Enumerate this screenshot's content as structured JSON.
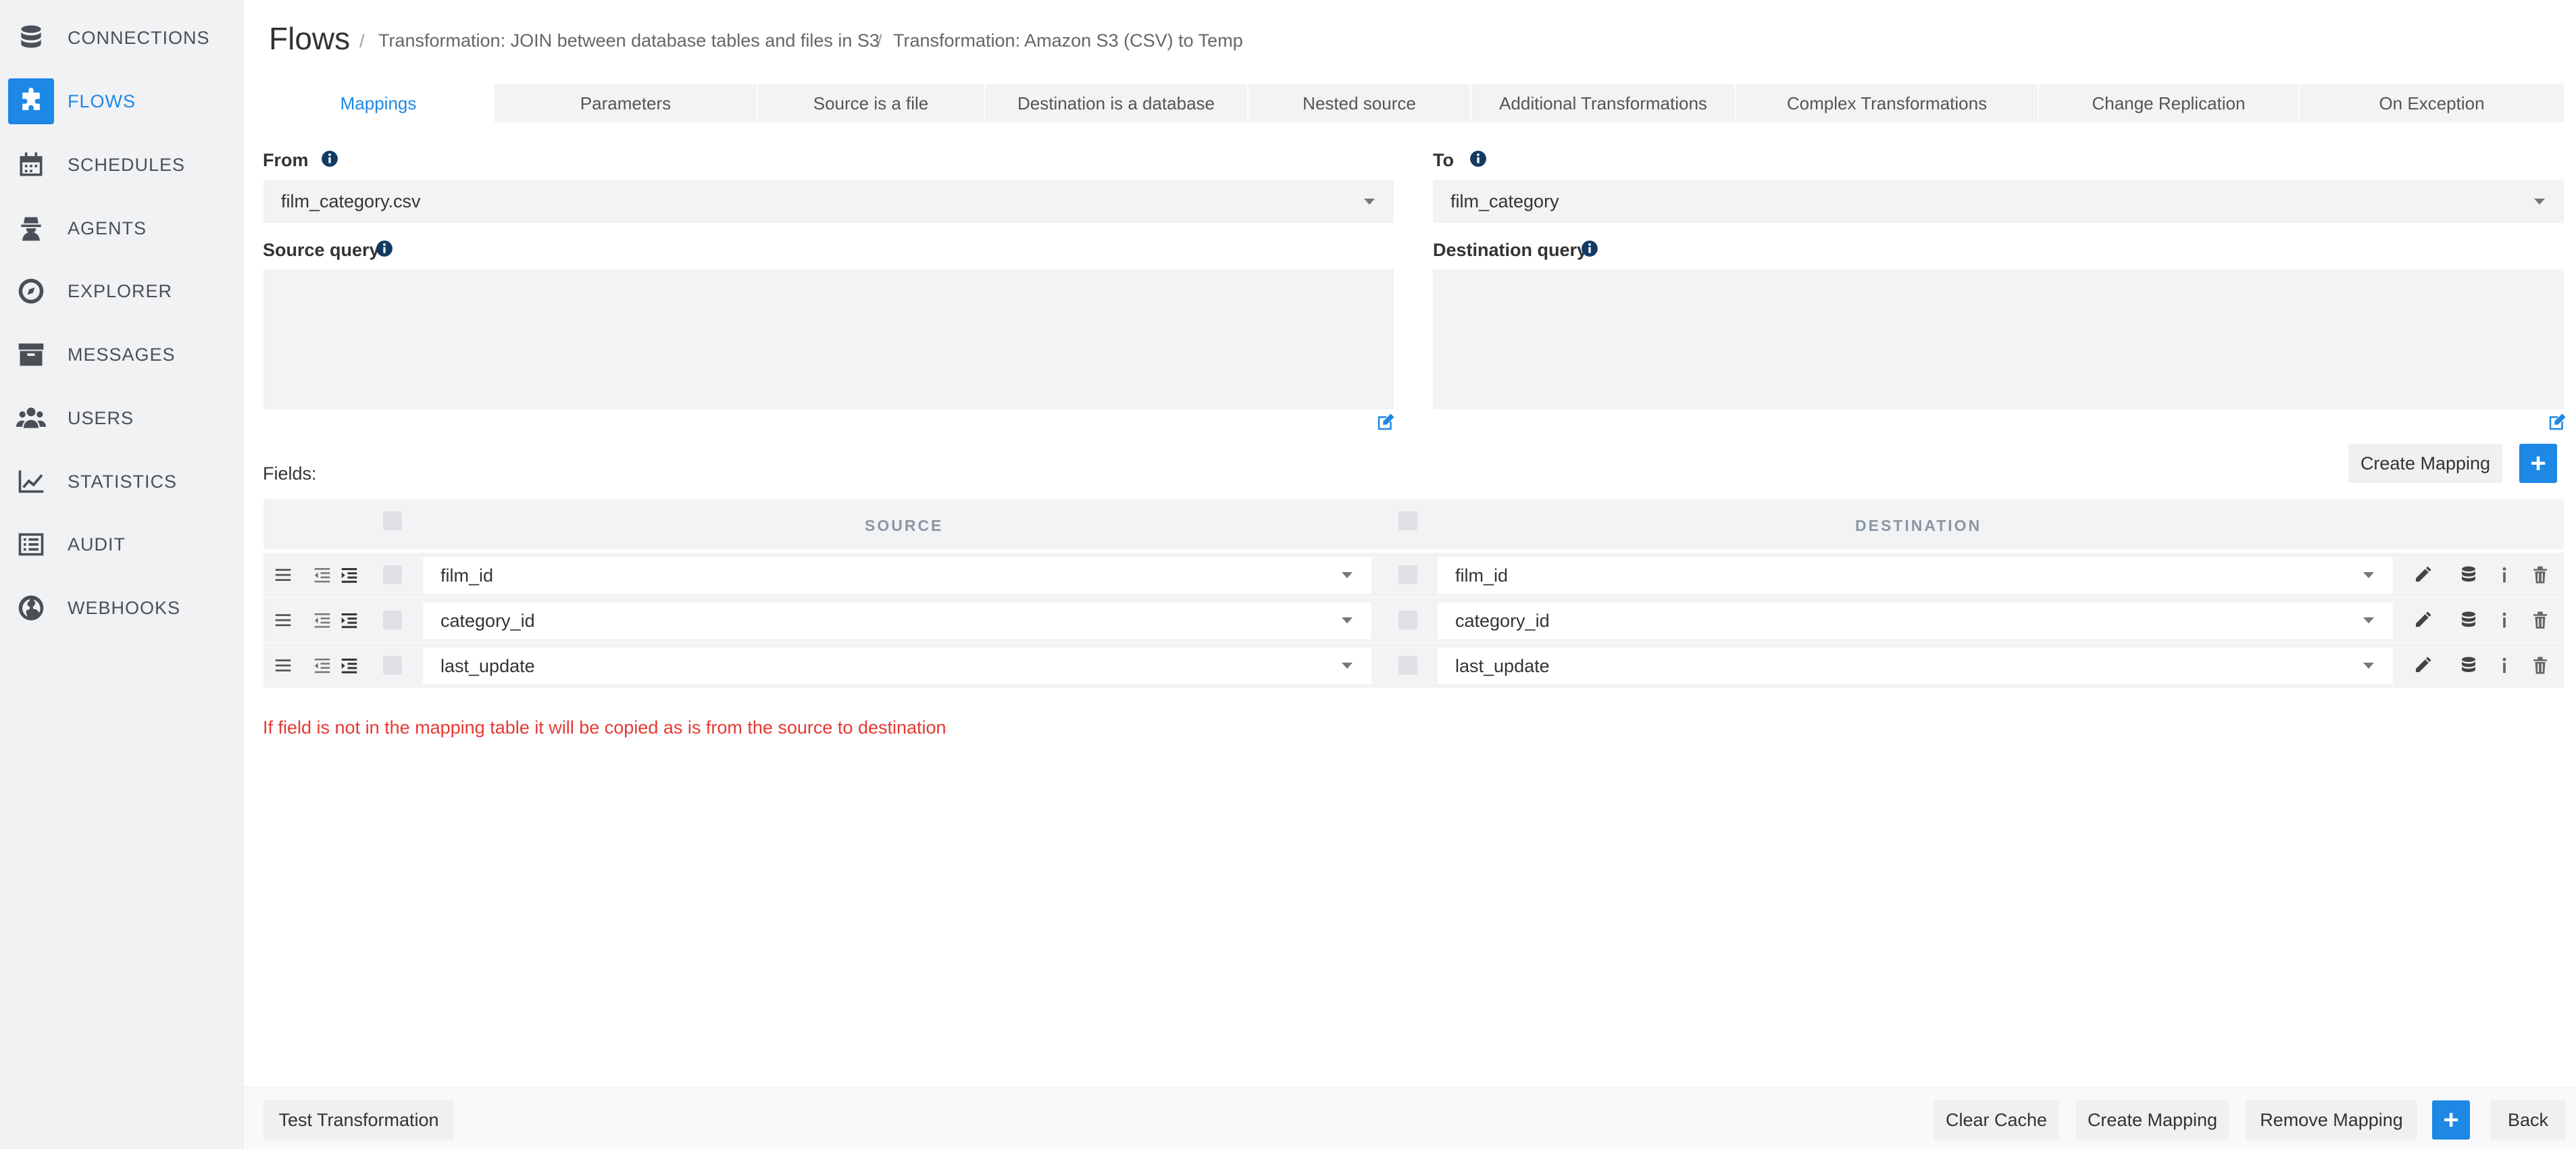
{
  "sidebar": {
    "items": [
      {
        "label": "CONNECTIONS",
        "icon": "database-icon"
      },
      {
        "label": "FLOWS",
        "icon": "puzzle-icon",
        "active": true
      },
      {
        "label": "SCHEDULES",
        "icon": "calendar-icon"
      },
      {
        "label": "AGENTS",
        "icon": "agent-icon"
      },
      {
        "label": "EXPLORER",
        "icon": "compass-icon"
      },
      {
        "label": "MESSAGES",
        "icon": "archive-icon"
      },
      {
        "label": "USERS",
        "icon": "users-icon"
      },
      {
        "label": "STATISTICS",
        "icon": "chart-line-icon"
      },
      {
        "label": "AUDIT",
        "icon": "list-icon"
      },
      {
        "label": "WEBHOOKS",
        "icon": "globe-icon"
      }
    ]
  },
  "header": {
    "title": "Flows",
    "breadcrumbs": [
      "Transformation: JOIN between database tables and files in S3",
      "Transformation: Amazon S3 (CSV) to Temp"
    ]
  },
  "tabs": [
    "Mappings",
    "Parameters",
    "Source is a file",
    "Destination is a database",
    "Nested source",
    "Additional Transformations",
    "Complex Transformations",
    "Change Replication",
    "On Exception"
  ],
  "form": {
    "from_label": "From",
    "from_value": "film_category.csv",
    "to_label": "To",
    "to_value": "film_category",
    "source_query_label": "Source query",
    "destination_query_label": "Destination query"
  },
  "fields": {
    "label": "Fields:",
    "create_mapping": "Create Mapping",
    "source_header": "SOURCE",
    "destination_header": "DESTINATION",
    "rows": [
      {
        "source": "film_id",
        "destination": "film_id"
      },
      {
        "source": "category_id",
        "destination": "category_id"
      },
      {
        "source": "last_update",
        "destination": "last_update"
      }
    ],
    "note": "If field is not in the mapping table it will be copied as is from the source to destination"
  },
  "footer": {
    "test": "Test Transformation",
    "clear_cache": "Clear Cache",
    "create_mapping": "Create Mapping",
    "remove_mapping": "Remove Mapping",
    "back": "Back"
  },
  "colors": {
    "accent": "#1e88e5",
    "note": "#e53935",
    "sidebar_bg": "#f1f2f4"
  }
}
